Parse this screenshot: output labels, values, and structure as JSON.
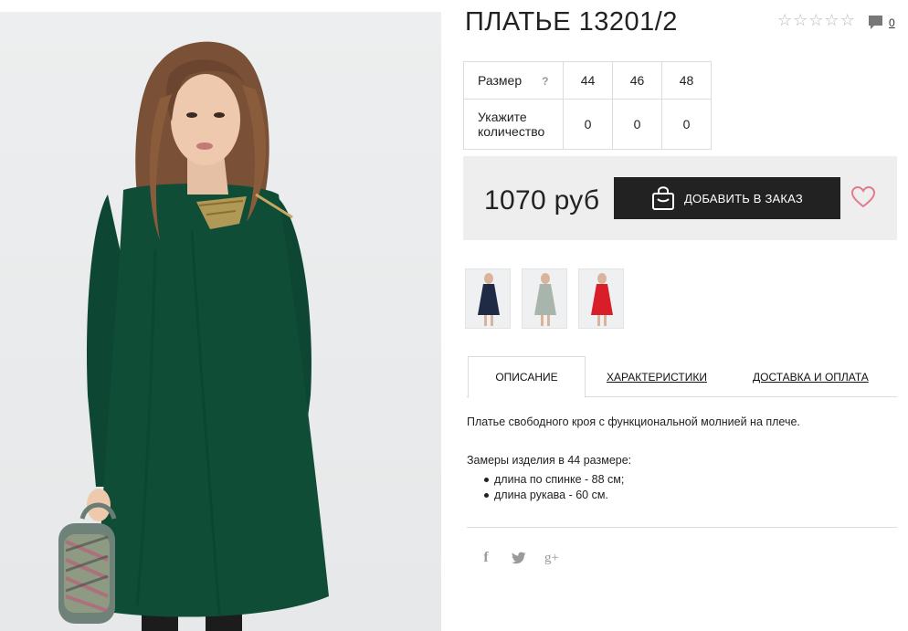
{
  "product": {
    "title": "ПЛАТЬЕ 13201/2",
    "rating_icon": "star-outline-icon",
    "rating_stars": 0,
    "comment_count": "0"
  },
  "sizes": {
    "size_label": "Размер",
    "help_mark": "?",
    "values": [
      "44",
      "46",
      "48"
    ],
    "qty_label": "Укажите количество",
    "qty": [
      "0",
      "0",
      "0"
    ]
  },
  "purchase": {
    "price": "1070 руб",
    "order_button": "ДОБАВИТЬ В ЗАКАЗ",
    "bag_icon": "shopping-bag-icon",
    "favorite_icon": "heart-icon",
    "accent_color": "#e17b8c",
    "button_color": "#222222"
  },
  "thumbnails": [
    {
      "name": "thumb-navy",
      "color": "#1f2a44"
    },
    {
      "name": "thumb-gray",
      "color": "#a8b5ac"
    },
    {
      "name": "thumb-red",
      "color": "#d81e28"
    }
  ],
  "tabs": {
    "description": "ОПИСАНИЕ",
    "characteristics": "ХАРАКТЕРИСТИКИ",
    "delivery": "ДОСТАВКА И ОПЛАТА"
  },
  "description": {
    "text": "Платье свободного кроя с функциональной молнией на плече.",
    "measures_title": "Замеры изделия в 44 размере:",
    "measures": [
      "длина по спинке - 88 см;",
      "длина рукава - 60 см."
    ]
  },
  "social": {
    "facebook": "f",
    "twitter": "twitter-icon",
    "google": "g+"
  }
}
